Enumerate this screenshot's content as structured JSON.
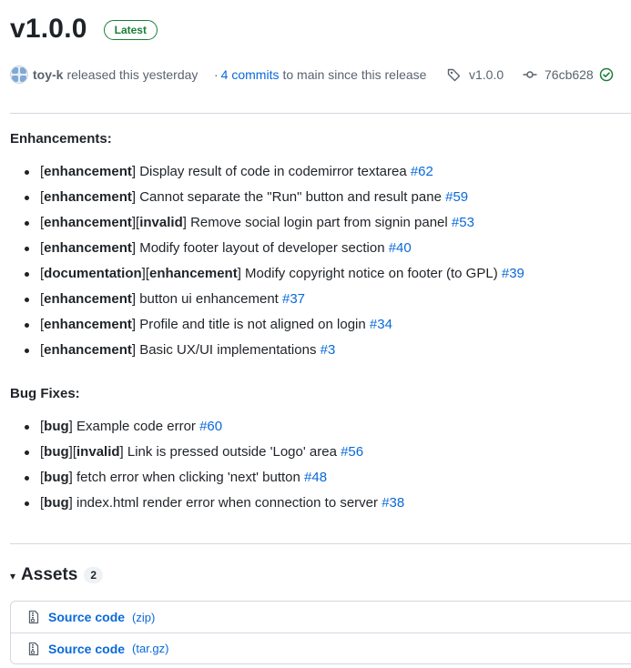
{
  "release": {
    "title": "v1.0.0",
    "badge": "Latest",
    "author": "toy-k",
    "released_text": "released this yesterday",
    "commits_prefix": "·",
    "commits_link": "4 commits",
    "commits_suffix": "to main since this release",
    "tag": "v1.0.0",
    "commit_sha": "76cb628"
  },
  "enhancements": {
    "heading": "Enhancements:",
    "items": [
      {
        "open": "[",
        "labels": "enhancement",
        "close": "]",
        "text": " Display result of code in codemirror textarea ",
        "issue": "#62"
      },
      {
        "open": "[",
        "labels": "enhancement",
        "close": "]",
        "text": " Cannot separate the \"Run\" button and result pane ",
        "issue": "#59"
      },
      {
        "open": "[",
        "labels": "enhancement",
        "close": "][",
        "labels2": "invalid",
        "close2": "]",
        "text": " Remove social login part from signin panel ",
        "issue": "#53"
      },
      {
        "open": "[",
        "labels": "enhancement",
        "close": "]",
        "text": " Modify footer layout of developer section ",
        "issue": "#40"
      },
      {
        "open": "[",
        "labels": "documentation",
        "close": "][",
        "labels2": "enhancement",
        "close2": "]",
        "text": " Modify copyright notice on footer (to GPL) ",
        "issue": "#39"
      },
      {
        "open": "[",
        "labels": "enhancement",
        "close": "]",
        "text": " button ui enhancement ",
        "issue": "#37"
      },
      {
        "open": "[",
        "labels": "enhancement",
        "close": "]",
        "text": " Profile and title is not aligned on login ",
        "issue": "#34"
      },
      {
        "open": "[",
        "labels": "enhancement",
        "close": "]",
        "text": " Basic UX/UI implementations ",
        "issue": "#3"
      }
    ]
  },
  "bug_fixes": {
    "heading": "Bug Fixes:",
    "items": [
      {
        "open": "[",
        "labels": "bug",
        "close": "]",
        "text": " Example code error ",
        "issue": "#60"
      },
      {
        "open": "[",
        "labels": "bug",
        "close": "][",
        "labels2": "invalid",
        "close2": "]",
        "text": " Link is pressed outside 'Logo' area ",
        "issue": "#56"
      },
      {
        "open": "[",
        "labels": "bug",
        "close": "]",
        "text": " fetch error when clicking 'next' button ",
        "issue": "#48"
      },
      {
        "open": "[",
        "labels": "bug",
        "close": "]",
        "text": " index.html render error when connection to server ",
        "issue": "#38"
      }
    ]
  },
  "assets": {
    "caret": "▾",
    "title": "Assets",
    "count": "2",
    "items": [
      {
        "name": "Source code",
        "ext": "(zip)"
      },
      {
        "name": "Source code",
        "ext": "(tar.gz)"
      }
    ]
  },
  "icons": {
    "tag": "tag-icon",
    "commit": "git-commit-icon",
    "verified": "check-circle-icon",
    "zip": "file-zip-icon",
    "caret": "triangle-down-icon"
  },
  "colors": {
    "link": "#0969da",
    "success": "#1a7f37",
    "text": "#1f2328",
    "muted": "#59636e",
    "border": "#d1d9e0"
  }
}
